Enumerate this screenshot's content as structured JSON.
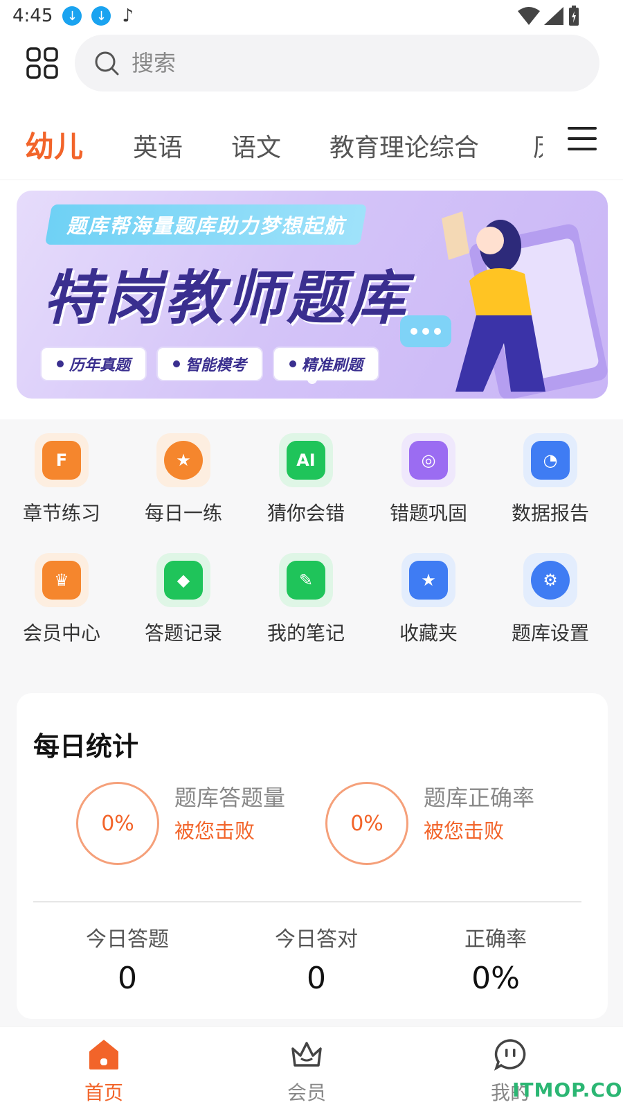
{
  "status_bar": {
    "time": "4:45"
  },
  "search": {
    "placeholder": "搜索"
  },
  "tabs": [
    {
      "label": "幼儿",
      "active": true
    },
    {
      "label": "英语"
    },
    {
      "label": "语文"
    },
    {
      "label": "教育理论综合"
    }
  ],
  "banner": {
    "subtitle": "题库帮海量题库助力梦想起航",
    "headline": "特岗教师题库",
    "pills": [
      "历年真题",
      "智能模考",
      "精准刷题"
    ]
  },
  "grid": {
    "items": [
      {
        "label": "章节练习",
        "icon": "chapter-practice-icon",
        "bg": "#fdeee0",
        "color": "#f5862d"
      },
      {
        "label": "每日一练",
        "icon": "daily-practice-icon",
        "bg": "#fdeee0",
        "color": "#f5862d"
      },
      {
        "label": "猜你会错",
        "icon": "ai-guess-icon",
        "bg": "#dff6e6",
        "color": "#1fc45a"
      },
      {
        "label": "错题巩固",
        "icon": "mistake-review-icon",
        "bg": "#efe8fc",
        "color": "#9b6cf2"
      },
      {
        "label": "数据报告",
        "icon": "data-report-icon",
        "bg": "#e3edfd",
        "color": "#3f7cf3"
      },
      {
        "label": "会员中心",
        "icon": "member-center-icon",
        "bg": "#fdeee0",
        "color": "#f5862d"
      },
      {
        "label": "答题记录",
        "icon": "answer-record-icon",
        "bg": "#dff6e6",
        "color": "#1fc45a"
      },
      {
        "label": "我的笔记",
        "icon": "notes-icon",
        "bg": "#dff6e6",
        "color": "#1fc45a"
      },
      {
        "label": "收藏夹",
        "icon": "favorites-icon",
        "bg": "#e3edfd",
        "color": "#3f7cf3"
      },
      {
        "label": "题库设置",
        "icon": "settings-icon",
        "bg": "#e3edfd",
        "color": "#3f7cf3"
      }
    ]
  },
  "daily_stats": {
    "title": "每日统计",
    "rings": [
      {
        "value": "0%",
        "label": "题库答题量",
        "sub": "被您击败"
      },
      {
        "value": "0%",
        "label": "题库正确率",
        "sub": "被您击败"
      }
    ],
    "stats": [
      {
        "label": "今日答题",
        "value": "0"
      },
      {
        "label": "今日答对",
        "value": "0"
      },
      {
        "label": "正确率",
        "value": "0%"
      }
    ]
  },
  "bottom_nav": [
    {
      "label": "首页",
      "active": true
    },
    {
      "label": "会员"
    },
    {
      "label": "我的"
    }
  ],
  "watermark": "ITMOP.COM",
  "colors": {
    "accent": "#f2642a",
    "ring": "#f5a07a",
    "page_bg": "#f7f7f8"
  }
}
